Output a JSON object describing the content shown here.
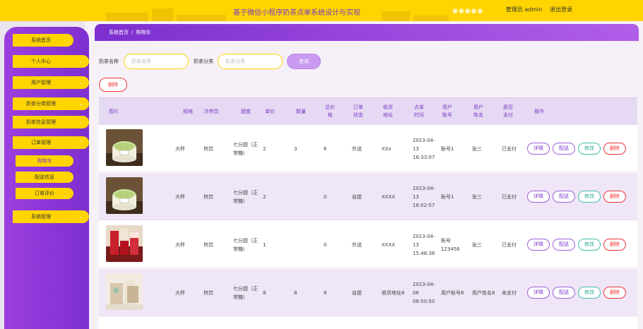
{
  "header": {
    "title": "基于微信小程序奶茶点单系统设计与实现",
    "user_text": "管理员 admin",
    "logout": "退出登录"
  },
  "sidebar": {
    "items": [
      {
        "label": "系统首页",
        "expandable": false
      },
      {
        "label": "个人中心",
        "expandable": true
      },
      {
        "label": "用户管理",
        "expandable": true
      },
      {
        "label": "奶茶分类管理",
        "expandable": true
      },
      {
        "label": "奶茶信息管理",
        "expandable": true
      },
      {
        "label": "订单管理",
        "expandable": true,
        "expanded": true
      },
      {
        "label": "系统管理",
        "expandable": true
      }
    ],
    "sub_items": [
      "购物车",
      "配送信息",
      "订单评价"
    ]
  },
  "breadcrumb": {
    "home": "系统首页",
    "separator": "/",
    "current": "购物车"
  },
  "filters": {
    "name_label": "奶茶名称",
    "name_placeholder": "奶茶名称",
    "category_label": "奶茶分类",
    "category_placeholder": "奶茶分类",
    "search": "查询"
  },
  "bulk_delete": "删除",
  "table": {
    "headers": {
      "image": "图片",
      "spec": "规格",
      "temp": "冷热饮",
      "sweet": "甜度",
      "price": "单价",
      "qty": "数量",
      "total": "总价格",
      "status": "订单状态",
      "address": "收货地址",
      "time": "点单时间",
      "account": "用户账号",
      "name": "用户姓名",
      "paid": "是否支付",
      "ops": "操作"
    },
    "rows": [
      {
        "image": "matcha-cup",
        "spec": "大杯",
        "temp": "热饮",
        "sweet": "七分甜（正常糖）",
        "price": "2",
        "qty": "3",
        "total": "6",
        "status": "外送",
        "address": "XXx",
        "time": "2023-04-13 16:33:07",
        "account": "账号1",
        "name": "张三",
        "paid": "已支付"
      },
      {
        "image": "matcha-cup",
        "spec": "大杯",
        "temp": "热饮",
        "sweet": "七分甜（正常糖）",
        "price": "2",
        "qty": "",
        "total": "0",
        "status": "自提",
        "address": "XXXX",
        "time": "2023-04-13 16:02:57",
        "account": "账号1",
        "name": "张三",
        "paid": "已支付"
      },
      {
        "image": "red-drinks",
        "spec": "大杯",
        "temp": "热饮",
        "sweet": "七分甜（正常糖）",
        "price": "1",
        "qty": "",
        "total": "0",
        "status": "外送",
        "address": "XXXX",
        "time": "2023-04-13 15:48:36",
        "account": "账号123456",
        "name": "张三",
        "paid": "已支付"
      },
      {
        "image": "beige-bags",
        "spec": "大杯",
        "temp": "热饮",
        "sweet": "七分甜（正常糖）",
        "price": "8",
        "qty": "8",
        "total": "8",
        "status": "自提",
        "address": "收货地址8",
        "time": "2023-04-06 08:50:50",
        "account": "用户账号8",
        "name": "用户姓名8",
        "paid": "未支付"
      }
    ],
    "actions": {
      "detail": "详情",
      "dist": "配送",
      "edit": "修改",
      "remove": "删除"
    }
  }
}
